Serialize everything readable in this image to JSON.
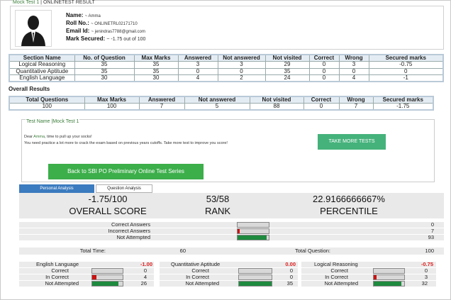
{
  "header": {
    "title_left": "Mock Test 1",
    "title_sep": " | ",
    "title_right": "ONLINETEST RESULT"
  },
  "profile": {
    "avatar_icon": "person-avatar-icon",
    "name_label": "Name:",
    "name_value": "~ Amma",
    "roll_label": "Roll No.:",
    "roll_value": "~ ONLINETRL02171710",
    "email_label": "Email Id:",
    "email_value": "~ jenindras7788@gmail.com",
    "mark_label": "Mark Secured:",
    "mark_value": "~ -1.75 out of 100"
  },
  "section_table": {
    "headers": [
      "Section Name",
      "No. of Question",
      "Max Marks",
      "Answered",
      "Not answered",
      "Not visited",
      "Correct",
      "Wrong",
      "Secured marks"
    ],
    "rows": [
      [
        "Logical Reasoning",
        "35",
        "35",
        "3",
        "3",
        "29",
        "0",
        "3",
        "-0.75"
      ],
      [
        "Quantitative Aptitude",
        "35",
        "35",
        "0",
        "0",
        "35",
        "0",
        "0",
        "0"
      ],
      [
        "English Language",
        "30",
        "30",
        "4",
        "2",
        "24",
        "0",
        "4",
        "-1"
      ]
    ]
  },
  "overall": {
    "label": "Overall Results",
    "headers": [
      "Total Questions",
      "Max Marks",
      "Answered",
      "Not answered",
      "Not visited",
      "Correct",
      "Wrong",
      "Secured marks"
    ],
    "row": [
      "100",
      "100",
      "7",
      "5",
      "88",
      "0",
      "7",
      "-1.75"
    ]
  },
  "test_box": {
    "title": "Test Name |Mock Test 1",
    "dear_prefix": "Dear ",
    "dear_name": "Amma",
    "dear_suffix": ", time to pull up your socks!",
    "message": "You need practice a lot more to crack the exam based on previous years cutoffs. Take more test to improve you score!",
    "take_more_button": "TAKE MORE TESTS",
    "back_button": "Back to SBI PO Preliminary Online Test Series"
  },
  "tabs": {
    "personal": "Personal Analysis",
    "question": "Question Analysis"
  },
  "scores": {
    "score_value": "-1.75/100",
    "score_label": "OVERALL SCORE",
    "rank_value": "53/58",
    "rank_label": "RANK",
    "percentile_value": "22.9166666667%",
    "percentile_label": "PERCENTILE"
  },
  "answers": {
    "correct_label": "Correct Answers",
    "correct_value": "0",
    "correct_fraction": 0,
    "incorrect_label": "Incorrect Answers",
    "incorrect_value": "7",
    "incorrect_fraction": 0.07,
    "not_attempted_label": "Not Attempted",
    "not_attempted_value": "93",
    "not_attempted_fraction": 0.93
  },
  "totals": {
    "time_label": "Total Time:",
    "time_value": "60",
    "question_label": "Total Question:",
    "question_value": "100"
  },
  "sections": [
    {
      "name": "English Language",
      "score": "-1.00",
      "correct_label": "Correct",
      "correct": "0",
      "correct_fraction": 0,
      "incorrect_label": "In Correct",
      "incorrect": "4",
      "incorrect_fraction": 0.13,
      "na_label": "Not Attempted",
      "na": "26",
      "na_fraction": 0.87
    },
    {
      "name": "Quantitative Aptitude",
      "score": "0.00",
      "correct_label": "Correct",
      "correct": "0",
      "correct_fraction": 0,
      "incorrect_label": "In Correct",
      "incorrect": "0",
      "incorrect_fraction": 0,
      "na_label": "Not Attempted",
      "na": "35",
      "na_fraction": 1.0
    },
    {
      "name": "Logical Reasoning",
      "score": "-0.75",
      "correct_label": "Correct",
      "correct": "0",
      "correct_fraction": 0,
      "incorrect_label": "In Correct",
      "incorrect": "3",
      "incorrect_fraction": 0.09,
      "na_label": "Not Attempted",
      "na": "32",
      "na_fraction": 0.91
    }
  ],
  "colors": {
    "accent_green": "#3cae4a",
    "tab_blue": "#3b7bbf",
    "bar_red": "#cc1111",
    "bar_green": "#1e8a3e",
    "negative": "#e02020"
  }
}
